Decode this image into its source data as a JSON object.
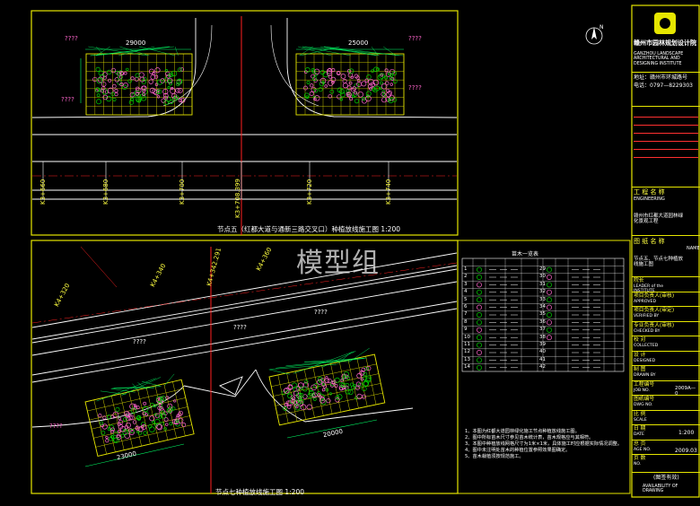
{
  "drawing_top": {
    "title": "节点五（红都大道与通新三路交叉口）种植放线施工图 1:200",
    "dim_left": "29000",
    "dim_right": "25000",
    "stations": [
      "K3+660",
      "K3+680",
      "K3+700",
      "K3+708.399",
      "K3+720",
      "K3+740"
    ],
    "unknown_labels": [
      "????",
      "????",
      "????",
      "????"
    ]
  },
  "drawing_bottom": {
    "title": "节点七种植放线施工图 1:200",
    "dim_left": "23000",
    "dim_right": "20000",
    "stations": [
      "K4+320",
      "K4+340",
      "K4+342.291",
      "K4+360"
    ],
    "unknown_labels": [
      "????",
      "????",
      "????",
      "????"
    ]
  },
  "plant_table": {
    "title": "苗木一览表",
    "left_numbers": [
      "1",
      "2",
      "3",
      "4",
      "5",
      "6",
      "7",
      "8",
      "9",
      "10",
      "11",
      "12",
      "13",
      "14"
    ],
    "right_numbers": [
      "29",
      "30",
      "31",
      "32",
      "33",
      "34",
      "35",
      "36",
      "37",
      "38",
      "39",
      "40",
      "41",
      "42"
    ]
  },
  "notes": [
    "1、本图为红都大道园林绿化施工节点种植放线施工图。",
    "2、图中所标苗木尺寸参见苗木统计表，苗木规格应与其相符。",
    "3、本图中种植放线网格尺寸为1米×1米，具体施工时应根据实际情况调整。",
    "4、图中未注明处苗木的种植位置参照效果图确定。",
    "5、苗木栽植须按规范施工。"
  ],
  "title_block": {
    "institute_cn": "赣州市园林规划设计院",
    "institute_en": "GANZHOU LANDSCAPE ARCHITECTURAL AND DESIGNING INSTITUTE",
    "address": "地址：赣州市环城路号",
    "phone": "电话：0797—8229303",
    "project_name_label": "工 程 名 称",
    "project_name_en": "ENGINEERING",
    "project_name": "赣州市红都大道园林绿化景观工程",
    "drawing_name_label": "图 纸 名 称",
    "drawing_name_en": "NAME",
    "drawing_name": "节点五、节点七种植放线施工图",
    "roles": [
      {
        "cn": "院长",
        "en": "LEADER of the INSTITUTE"
      },
      {
        "cn": "项目负责人(审核)",
        "en": "APPROVED"
      },
      {
        "cn": "项目负责人(审定)",
        "en": "VERIFIED BY"
      },
      {
        "cn": "专业负责人(审核)",
        "en": "CHECKED BY"
      },
      {
        "cn": "校 对",
        "en": "COLLECTED"
      },
      {
        "cn": "设 计",
        "en": "DESIGNED"
      },
      {
        "cn": "制 图",
        "en": "DRAWN BY"
      },
      {
        "cn": "工程编号",
        "en": "JOB NO."
      },
      {
        "cn": "图纸编号",
        "en": "DWG NO."
      },
      {
        "cn": "比 例",
        "en": "SCALE"
      },
      {
        "cn": "日 期",
        "en": "DATE"
      },
      {
        "cn": "总 页",
        "en": "AGE NO."
      },
      {
        "cn": "页 数",
        "en": "NO."
      }
    ],
    "job_no": "2009A—0",
    "scale": "1:200",
    "date": "2009.03",
    "validity_cn": "(图签有效)",
    "validity_en": "AVAILABILITY OF DRAWING"
  },
  "watermark": "模型组",
  "colors": {
    "frame": "#e6e600",
    "road": "#ffffff",
    "centerline": "#ff2020",
    "grid": "#e6e600",
    "shrub_green": "#00d000",
    "shrub_pink": "#ff66cc",
    "dimension": "#00ff66",
    "text": "#ffffff"
  }
}
